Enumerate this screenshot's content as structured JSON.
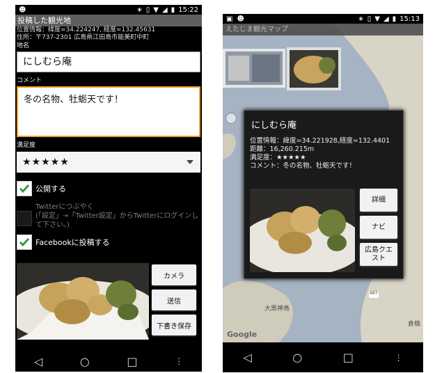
{
  "left": {
    "status": {
      "time": "15:22"
    },
    "title": "投稿した観光地",
    "info": {
      "location": "位置情報：緯度=34.224247, 経度=132.45631",
      "address": "住所：〒737-2301 広島県江田島市能美町中町"
    },
    "name_label": "地名",
    "name_value": "にしむら庵",
    "comment_label": "コメント",
    "comment_value": "冬の名物、牡蛎天です！",
    "rating_label": "満足度",
    "rating_value": "★★★★★",
    "rating_stars": 5,
    "public_label": "公開する",
    "public_checked": true,
    "twitter_label": "Twitterにつぶやく",
    "twitter_note": "(「設定」→「Twitter設定」からTwitterにログインして下さい。)",
    "twitter_checked": false,
    "facebook_label": "Facebookに投稿する",
    "facebook_checked": true,
    "buttons": {
      "camera": "カメラ",
      "send": "送信",
      "draft": "下書き保存"
    }
  },
  "right": {
    "status": {
      "time": "15:13"
    },
    "title": "えたじま観光マップ",
    "popup": {
      "title": "にしむら庵",
      "location": "位置情報：緯度=34.221928,経度=132.4401",
      "distance": "距離：16,260.215m",
      "rating": "満足度：★★★★★",
      "comment": "コメント：冬の名物、牡蛎天です！",
      "buttons": {
        "detail": "詳細",
        "navi": "ナビ",
        "quest": "広島クエスト"
      }
    },
    "map_label_place": "大黒神島",
    "map_label_town": "倉橋",
    "map_route_number": "487",
    "google_logo": "Google"
  },
  "colors": {
    "accent": "#f39c2b",
    "check": "#2e9f3c",
    "titlebar": "#5f5f5f"
  }
}
